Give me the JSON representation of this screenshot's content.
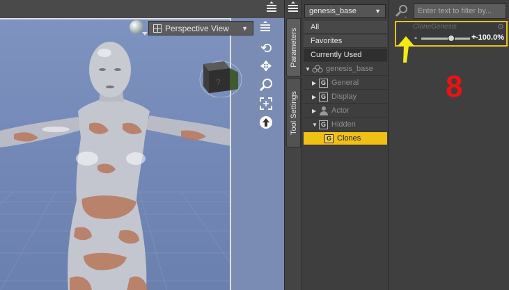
{
  "viewport": {
    "view_label": "Perspective View"
  },
  "side_tabs": [
    "Parameters",
    "Tool Settings"
  ],
  "tree": {
    "node_selector": "genesis_base",
    "rows": [
      {
        "label": "All",
        "type": "filter"
      },
      {
        "label": "Favorites",
        "type": "filter"
      },
      {
        "label": "Currently Used",
        "type": "filter"
      },
      {
        "label": "genesis_base",
        "type": "figure"
      },
      {
        "label": "General",
        "type": "group"
      },
      {
        "label": "Display",
        "type": "group"
      },
      {
        "label": "Actor",
        "type": "group"
      },
      {
        "label": "Hidden",
        "type": "group"
      },
      {
        "label": "Clones",
        "type": "group"
      }
    ]
  },
  "params": {
    "filter_placeholder": "Enter text to filter by...",
    "slider": {
      "name": "CloneGenesis",
      "minus": "-",
      "plus": "+",
      "value_text": "-100.0%",
      "position_fraction": 0.62
    },
    "annotation_number": "8"
  },
  "colors": {
    "selection": "#f0c014",
    "annotation_arrow": "#f2ea14",
    "annotation_text": "#ee1111"
  }
}
